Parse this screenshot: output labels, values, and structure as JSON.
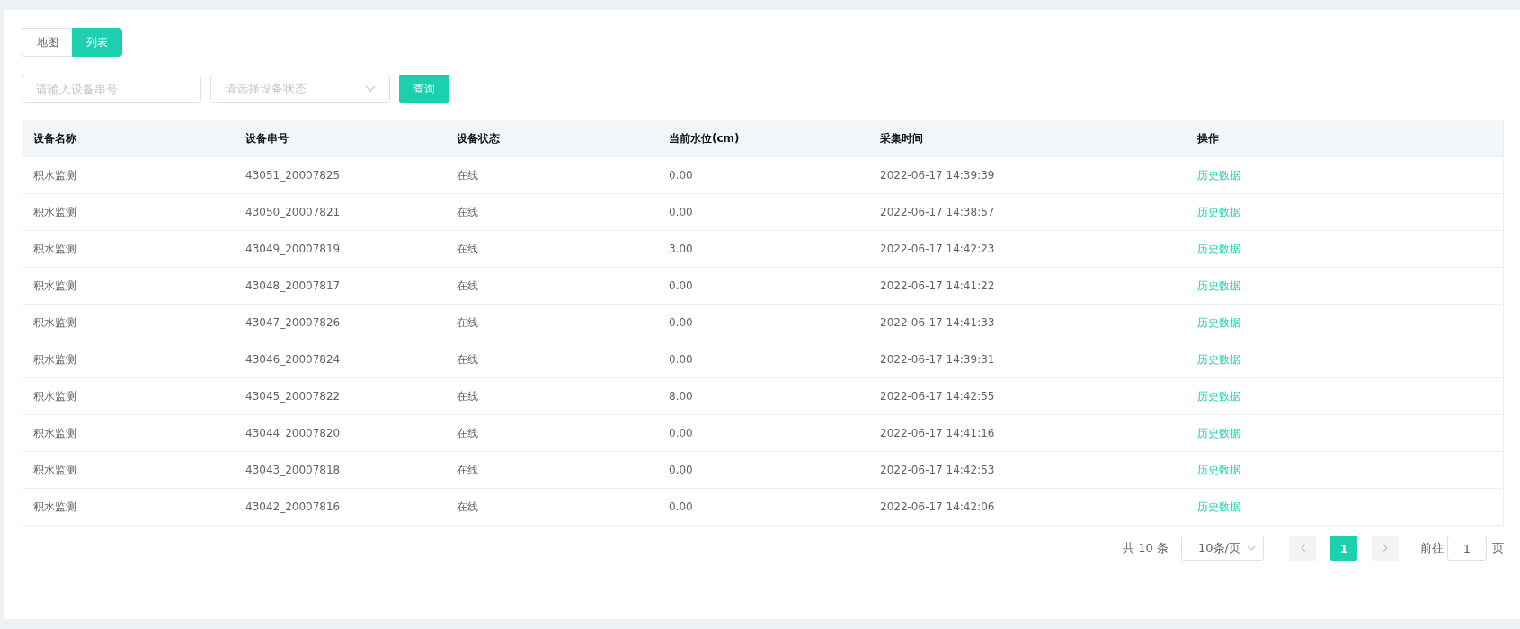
{
  "view_tabs": [
    {
      "label": "地图",
      "selected": false
    },
    {
      "label": "列表",
      "selected": true
    }
  ],
  "filters": {
    "serial_placeholder": "请输入设备串号",
    "status_placeholder": "请选择设备状态",
    "query_button": "查询"
  },
  "table": {
    "columns": [
      "设备名称",
      "设备串号",
      "设备状态",
      "当前水位(cm)",
      "采集时间",
      "操作"
    ],
    "rows": [
      {
        "name": "积水监测",
        "serial": "43051_20007825",
        "status": "在线",
        "level_cm": "0.00",
        "time": "2022-06-17 14:39:39",
        "action": "历史数据"
      },
      {
        "name": "积水监测",
        "serial": "43050_20007821",
        "status": "在线",
        "level_cm": "0.00",
        "time": "2022-06-17 14:38:57",
        "action": "历史数据"
      },
      {
        "name": "积水监测",
        "serial": "43049_20007819",
        "status": "在线",
        "level_cm": "3.00",
        "time": "2022-06-17 14:42:23",
        "action": "历史数据"
      },
      {
        "name": "积水监测",
        "serial": "43048_20007817",
        "status": "在线",
        "level_cm": "0.00",
        "time": "2022-06-17 14:41:22",
        "action": "历史数据"
      },
      {
        "name": "积水监测",
        "serial": "43047_20007826",
        "status": "在线",
        "level_cm": "0.00",
        "time": "2022-06-17 14:41:33",
        "action": "历史数据"
      },
      {
        "name": "积水监测",
        "serial": "43046_20007824",
        "status": "在线",
        "level_cm": "0.00",
        "time": "2022-06-17 14:39:31",
        "action": "历史数据"
      },
      {
        "name": "积水监测",
        "serial": "43045_20007822",
        "status": "在线",
        "level_cm": "8.00",
        "time": "2022-06-17 14:42:55",
        "action": "历史数据"
      },
      {
        "name": "积水监测",
        "serial": "43044_20007820",
        "status": "在线",
        "level_cm": "0.00",
        "time": "2022-06-17 14:41:16",
        "action": "历史数据"
      },
      {
        "name": "积水监测",
        "serial": "43043_20007818",
        "status": "在线",
        "level_cm": "0.00",
        "time": "2022-06-17 14:42:53",
        "action": "历史数据"
      },
      {
        "name": "积水监测",
        "serial": "43042_20007816",
        "status": "在线",
        "level_cm": "0.00",
        "time": "2022-06-17 14:42:06",
        "action": "历史数据"
      }
    ]
  },
  "pagination": {
    "total": "共 10 条",
    "page_size": "10条/页",
    "pages": [
      {
        "label": "1",
        "selected": true
      }
    ],
    "goto_label": "前往",
    "goto_value": "1",
    "page_suffix": "页"
  }
}
